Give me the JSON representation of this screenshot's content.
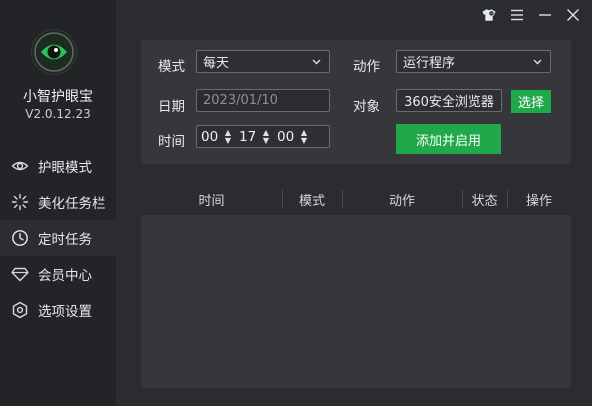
{
  "app": {
    "name": "小智护眼宝",
    "version": "V2.0.12.23"
  },
  "sidebar": {
    "items": [
      {
        "label": "护眼模式",
        "icon": "eye-icon",
        "active": false
      },
      {
        "label": "美化任务栏",
        "icon": "sparkle-icon",
        "active": false
      },
      {
        "label": "定时任务",
        "icon": "clock-icon",
        "active": true
      },
      {
        "label": "会员中心",
        "icon": "diamond-icon",
        "active": false
      },
      {
        "label": "选项设置",
        "icon": "settings-icon",
        "active": false
      }
    ]
  },
  "window_controls": [
    "skin-icon",
    "menu-icon",
    "minimize-icon",
    "close-icon"
  ],
  "form": {
    "mode_label": "模式",
    "mode_value": "每天",
    "action_label": "动作",
    "action_value": "运行程序",
    "date_label": "日期",
    "date_value": "2023/01/10",
    "target_label": "对象",
    "target_value": "360安全浏览器",
    "choose_button": "选择",
    "time_label": "时间",
    "time_hour": "00",
    "time_minute": "17",
    "time_second": "00",
    "add_button": "添加并启用"
  },
  "table": {
    "columns": [
      "时间",
      "模式",
      "动作",
      "状态",
      "操作"
    ],
    "rows": []
  },
  "colors": {
    "accent": "#1fa94b",
    "sidebar": "#232427",
    "background": "#2b2c2f",
    "panel": "#36373a"
  }
}
